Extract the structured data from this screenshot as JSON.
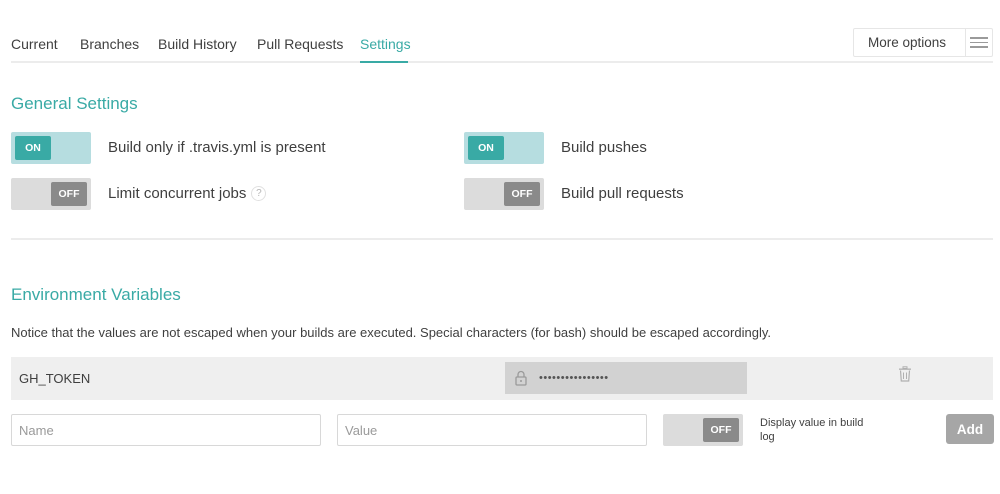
{
  "tabs": {
    "current": "Current",
    "branches": "Branches",
    "build_history": "Build History",
    "pull_requests": "Pull Requests",
    "settings": "Settings",
    "active": "Settings"
  },
  "more_options": {
    "label": "More options",
    "icon": "hamburger-menu-icon"
  },
  "general_settings": {
    "title": "General Settings",
    "build_only_travis": {
      "label": "Build only if .travis.yml is present",
      "state": "ON"
    },
    "build_pushes": {
      "label": "Build pushes",
      "state": "ON"
    },
    "limit_concurrent": {
      "label": "Limit concurrent jobs",
      "state": "OFF",
      "help": "?"
    },
    "build_pull_requests": {
      "label": "Build pull requests",
      "state": "OFF"
    }
  },
  "env_vars": {
    "title": "Environment Variables",
    "notice": "Notice that the values are not escaped when your builds are executed. Special characters (for bash) should be escaped accordingly.",
    "items": [
      {
        "name": "GH_TOKEN",
        "value": "••••••••••••••••"
      }
    ],
    "form": {
      "name_placeholder": "Name",
      "value_placeholder": "Value",
      "display_toggle_state": "OFF",
      "display_label": "Display value in build log",
      "add_label": "Add"
    }
  },
  "colors": {
    "accent": "#39aaa5",
    "toggle_on_track": "#b6dde0",
    "toggle_off_knob": "#8a8a8a",
    "add_button": "#a6a6a6"
  }
}
